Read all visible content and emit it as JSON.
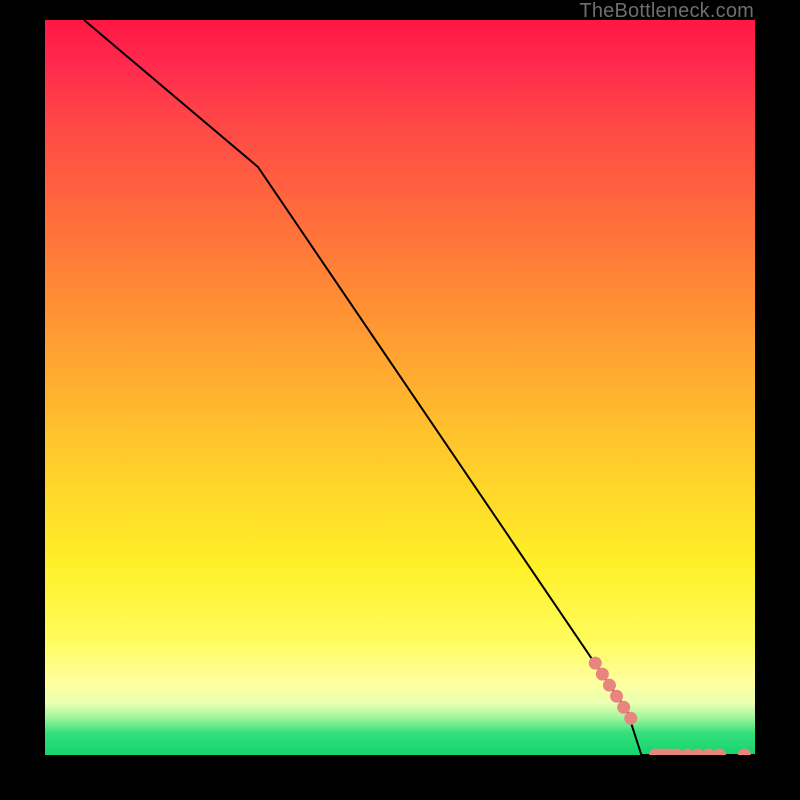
{
  "watermark": "TheBottleneck.com",
  "colors": {
    "line": "#000000",
    "marker_fill": "#e8857e",
    "marker_stroke": "#e8857e"
  },
  "chart_data": {
    "type": "line",
    "title": "",
    "xlabel": "",
    "ylabel": "",
    "xlim": [
      0,
      100
    ],
    "ylim": [
      0,
      100
    ],
    "grid": false,
    "legend": false,
    "series": [
      {
        "name": "curve",
        "kind": "line",
        "x": [
          5.5,
          30,
          82,
          84,
          100
        ],
        "y": [
          100,
          80,
          6,
          0,
          0
        ]
      },
      {
        "name": "markers",
        "kind": "scatter",
        "x": [
          77.5,
          78.5,
          79.5,
          80.5,
          81.5,
          82.5,
          86,
          87,
          88,
          89,
          90.5,
          92,
          93.5,
          95,
          98.5
        ],
        "y": [
          12.5,
          11,
          9.5,
          8,
          6.5,
          5,
          0,
          0,
          0,
          0,
          0,
          0,
          0,
          0,
          0
        ]
      }
    ]
  }
}
